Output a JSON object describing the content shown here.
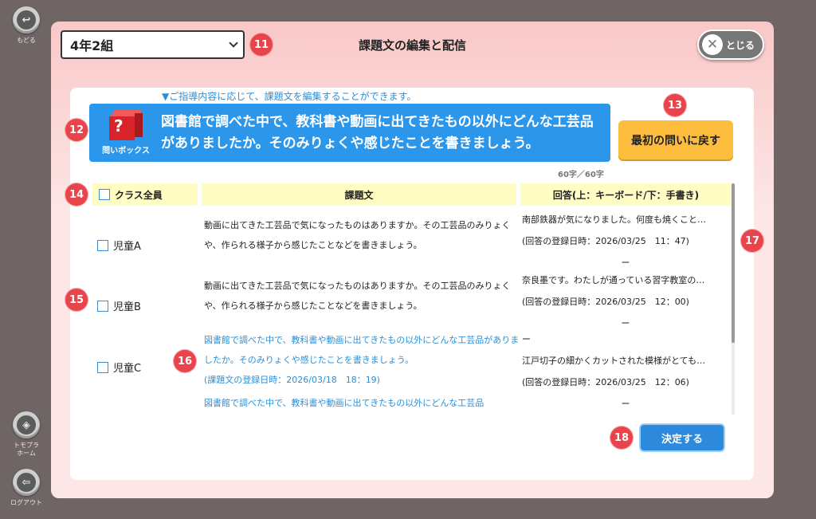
{
  "rail": {
    "back_label": "もどる",
    "home_label_1": "トモプラ",
    "home_label_2": "ホーム",
    "logout_label": "ログアウト"
  },
  "header": {
    "class_select_value": "4年2組",
    "title": "課題文の編集と配信",
    "close_label": "とじる"
  },
  "badges": [
    "11",
    "12",
    "13",
    "14",
    "15",
    "16",
    "17",
    "18"
  ],
  "hint": "▼ご指導内容に応じて、課題文を編集することができます。",
  "question_box": {
    "icon_label": "問いボックス",
    "text": "図書館で調べた中で、教科書や動画に出てきたもの以外にどんな工芸品がありましたか。そのみりょくや感じたことを書きましょう。"
  },
  "reset_label": "最初の問いに戻す",
  "char_count": "60字／60字",
  "table": {
    "col_all": "クラス全員",
    "col_prompt": "課題文",
    "col_answer": "回答(上：キーボード/下：手書き)",
    "rows": [
      {
        "student": "児童A",
        "prompt": "動画に出てきた工芸品で気になったものはありますか。その工芸品のみりょくや、作られる様子から感じたことなどを書きましょう。",
        "answer_line": "南部鉄器が気になりました。何度も焼くこと…",
        "answer_date": "(回答の登録日時：2026/03/25　11：47)",
        "answer_dash": "ー"
      },
      {
        "student": "児童B",
        "prompt": "動画に出てきた工芸品で気になったものはありますか。その工芸品のみりょくや、作られる様子から感じたことなどを書きましょう。",
        "answer_line": "奈良墨です。わたしが通っている習字教室の…",
        "answer_date": "(回答の登録日時：2026/03/25　12：00)",
        "answer_dash": "ー"
      },
      {
        "student": "児童C",
        "prompt_1": "図書館で調べた中で、教科書や動画に出てきたもの以外にどんな工芸品がありましたか。そのみりょくや感じたことを書きましょう。",
        "prompt_date": "(課題文の登録日時：2026/03/18　18：19)",
        "prompt_2": "図書館で調べた中で、教科書や動画に出てきたもの以外にどんな工芸品",
        "answer_dash_top": "ー",
        "answer_line": "江戸切子の細かくカットされた模様がとても…",
        "answer_date": "(回答の登録日時：2026/03/25　12：06)",
        "answer_dash": "ー"
      }
    ]
  },
  "submit_label": "決定する"
}
